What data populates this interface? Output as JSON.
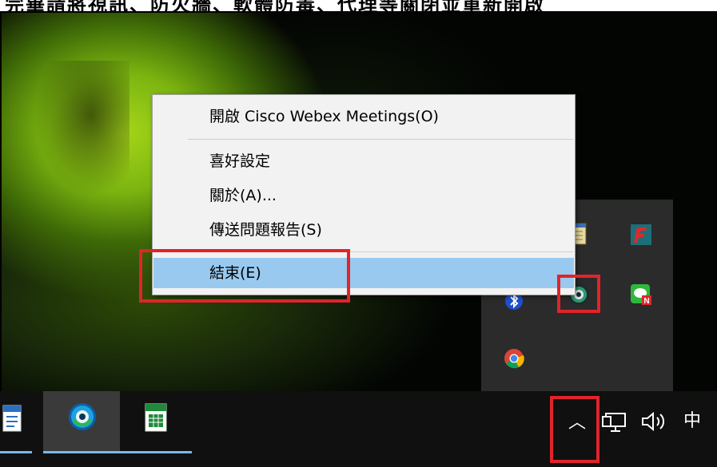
{
  "caption": {
    "text": "完畢請將視訊、防火牆、軟體防毒、代理等關閉並重新開啟"
  },
  "context_menu": {
    "items": [
      {
        "label": "開啟 Cisco Webex Meetings(O)",
        "highlighted": false
      },
      {
        "label": "喜好設定",
        "highlighted": false
      },
      {
        "label": "關於(A)...",
        "highlighted": false
      },
      {
        "label": "傳送問題報告(S)",
        "highlighted": false
      },
      {
        "label": "結束(E)",
        "highlighted": true
      }
    ]
  },
  "tray_flyout": {
    "icons": [
      "notepad-icon",
      "flash-app-icon",
      "bluetooth-icon",
      "webex-icon",
      "line-chat-icon",
      "chrome-icon"
    ]
  },
  "taskbar": {
    "apps": [
      "document-app-icon",
      "webex-app-icon",
      "spreadsheet-app-icon"
    ],
    "show_hidden_icons_glyph": "︿",
    "network_glyph": "🖧",
    "volume_glyph": "🔈",
    "ime_label": "中"
  },
  "colors": {
    "menu_bg": "#f2f2f2",
    "menu_highlight": "#99c9ef",
    "annotation_red": "#e0242a",
    "taskbar_bg": "#101010",
    "taskbar_accent": "#76b9ed"
  }
}
